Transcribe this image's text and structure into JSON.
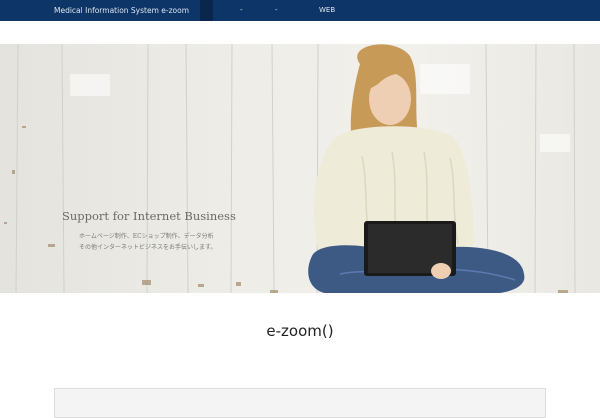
{
  "header": {
    "brand": "Medical Information System e-zoom",
    "nav": [
      {
        "label": "",
        "marker": "-"
      },
      {
        "label": "",
        "marker": "-"
      },
      {
        "label": "WEB",
        "marker": ""
      }
    ]
  },
  "hero": {
    "title": "Support for Internet Business",
    "lines": [
      "ホームページ制作、ECショップ制作、データ分析",
      "その他インターネットビジネスをお手伝いします。"
    ]
  },
  "main": {
    "title": "e-zoom()"
  },
  "colors": {
    "header_bg": "#0e3567",
    "nav_active_bg": "#09264d"
  }
}
